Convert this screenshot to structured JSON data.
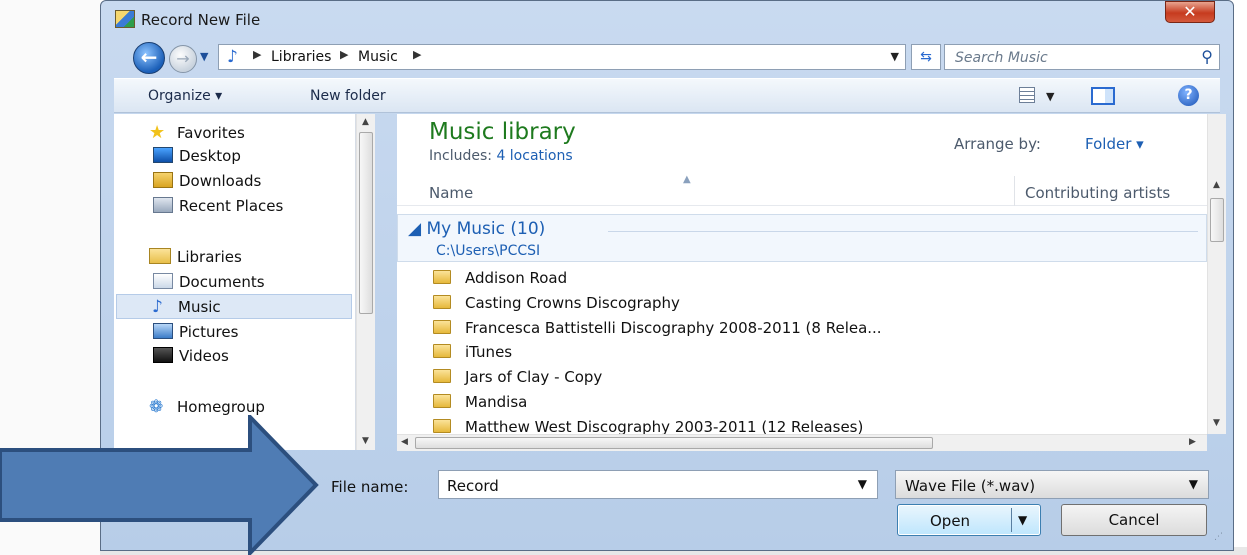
{
  "window": {
    "title": "Record New File",
    "close_glyph": "✕"
  },
  "nav": {
    "back_glyph": "←",
    "forward_glyph": "→",
    "breadcrumb": [
      {
        "label": "Libraries"
      },
      {
        "label": "Music"
      }
    ],
    "separator": "▶",
    "search_placeholder": "Search Music"
  },
  "toolbar": {
    "organize_label": "Organize ▾",
    "new_folder_label": "New folder",
    "help_glyph": "?"
  },
  "sidebar": {
    "favorites_label": "Favorites",
    "items": [
      {
        "label": "Desktop"
      },
      {
        "label": "Downloads"
      },
      {
        "label": "Recent Places"
      }
    ],
    "libraries_label": "Libraries",
    "library_items": [
      {
        "label": "Documents"
      },
      {
        "label": "Music",
        "selected": true
      },
      {
        "label": "Pictures"
      },
      {
        "label": "Videos"
      }
    ],
    "homegroup_label": "Homegroup"
  },
  "content": {
    "library_title": "Music library",
    "includes_prefix": "Includes:",
    "includes_link": "4 locations",
    "arrange_label": "Arrange by:",
    "arrange_value": "Folder ▾",
    "columns": {
      "name": "Name",
      "artist": "Contributing artists"
    },
    "group": {
      "title": "◢  My Music (10)",
      "path": "C:\\Users\\PCCSI"
    },
    "files": [
      {
        "name": "Addison Road"
      },
      {
        "name": "Casting Crowns Discography"
      },
      {
        "name": "Francesca Battistelli Discography 2008-2011 (8 Relea..."
      },
      {
        "name": "iTunes"
      },
      {
        "name": "Jars of Clay - Copy"
      },
      {
        "name": "Mandisa"
      },
      {
        "name": "Matthew West Discography 2003-2011 (12 Releases)"
      }
    ]
  },
  "form": {
    "file_name_label": "File name:",
    "file_name_value": "Record",
    "file_type_value": "Wave File (*.wav)",
    "open_label": "Open",
    "cancel_label": "Cancel"
  },
  "colors": {
    "arrow_fill": "#4f7cb4",
    "arrow_stroke": "#2c4f7e",
    "library_title": "#1e7a1e",
    "link": "#1d5fb3"
  }
}
